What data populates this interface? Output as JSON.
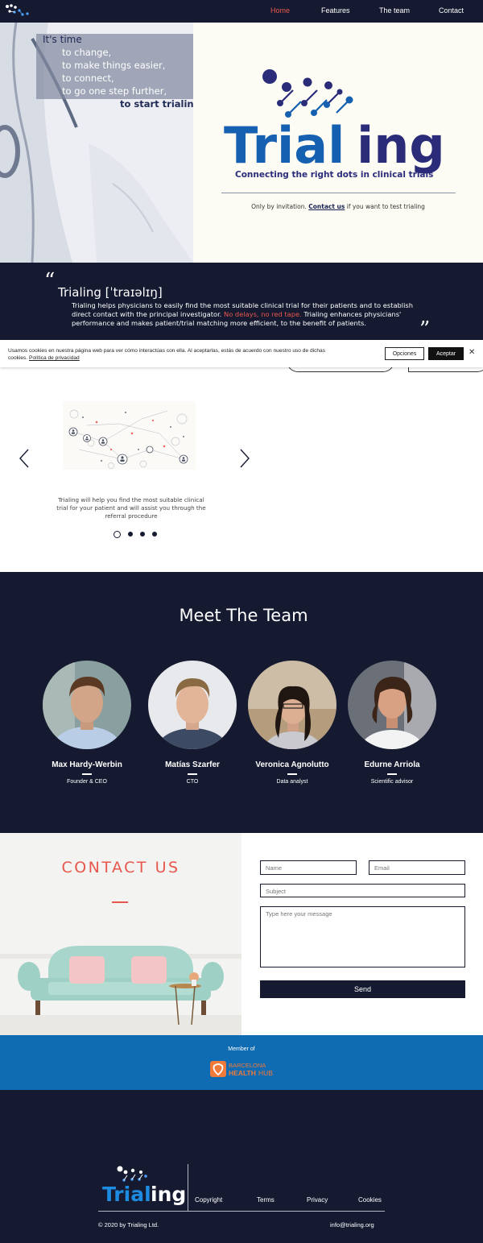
{
  "nav": {
    "items": [
      {
        "label": "Home",
        "active": true
      },
      {
        "label": "Features",
        "active": false
      },
      {
        "label": "The team",
        "active": false
      },
      {
        "label": "Contact",
        "active": false
      }
    ]
  },
  "hero": {
    "lines": [
      "It's time",
      "to change,",
      "to make things easier,",
      "to connect,",
      "to go one step further,",
      "to start trialing"
    ],
    "brand_name": "Trialing",
    "tagline": "Connecting the right dots in clinical trials",
    "invite_pre": "Only by invitation.",
    "invite_link": "Contact us",
    "invite_post": "if you want to test trialing"
  },
  "definition": {
    "title": "Trialing [ˈtraɪəlɪŋ]",
    "body_1": "Trialing helps physicians to easily find the most suitable clinical trial for their patients and to establish direct contact with the principal investigator.",
    "body_highlight": "No delays, no red tape.",
    "body_2": "Trialing enhances physicians' performance and makes patient/trial matching more efficient, to the benefit of patients.",
    "open_quote": "“",
    "close_quote": "”"
  },
  "cookie": {
    "text": "Usamos cookies en nuestra página web para ver cómo interactúas con ella. Al aceptarlas, estás de acuerdo con nuestro uso de dichas cookies.",
    "link": "Política de privacidad",
    "options_label": "Opciones",
    "accept_label": "Aceptar",
    "close_label": "✕"
  },
  "slider": {
    "text": "Trialing will help you find the most suitable clinical trial for your patient and will assist you through the referral procedure",
    "dot_count": 4,
    "active_dot": 0
  },
  "team": {
    "title": "Meet The Team",
    "members": [
      {
        "name": "Max Hardy-Werbin",
        "role": "Founder & CEO"
      },
      {
        "name": "Matías Szarfer",
        "role": "CTO"
      },
      {
        "name": "Veronica Agnolutto",
        "role": "Data analyst"
      },
      {
        "name": "Edurne Arriola",
        "role": "Scientific advisor"
      }
    ]
  },
  "contact": {
    "title": "CONTACT US",
    "name_placeholder": "Name",
    "email_placeholder": "Email",
    "subject_placeholder": "Subject",
    "message_placeholder": "Type here your message",
    "send_label": "Send"
  },
  "member_band": {
    "label": "Member of",
    "logo_line1": "BARCELONA",
    "logo_line2": "HEALTH",
    "logo_line3": "HUB"
  },
  "footer": {
    "brand_name": "Trialing",
    "links": [
      "Copyright",
      "Terms",
      "Privacy",
      "Cookies"
    ],
    "copyright": "© 2020 by Trialing Ltd.",
    "email": "info@trialing.org"
  },
  "colors": {
    "navy": "#151a30",
    "accent_red": "#e8574d",
    "brand_blue": "#1560b0",
    "brand_indigo": "#2a2c7a",
    "band_blue": "#0f6bb2"
  }
}
